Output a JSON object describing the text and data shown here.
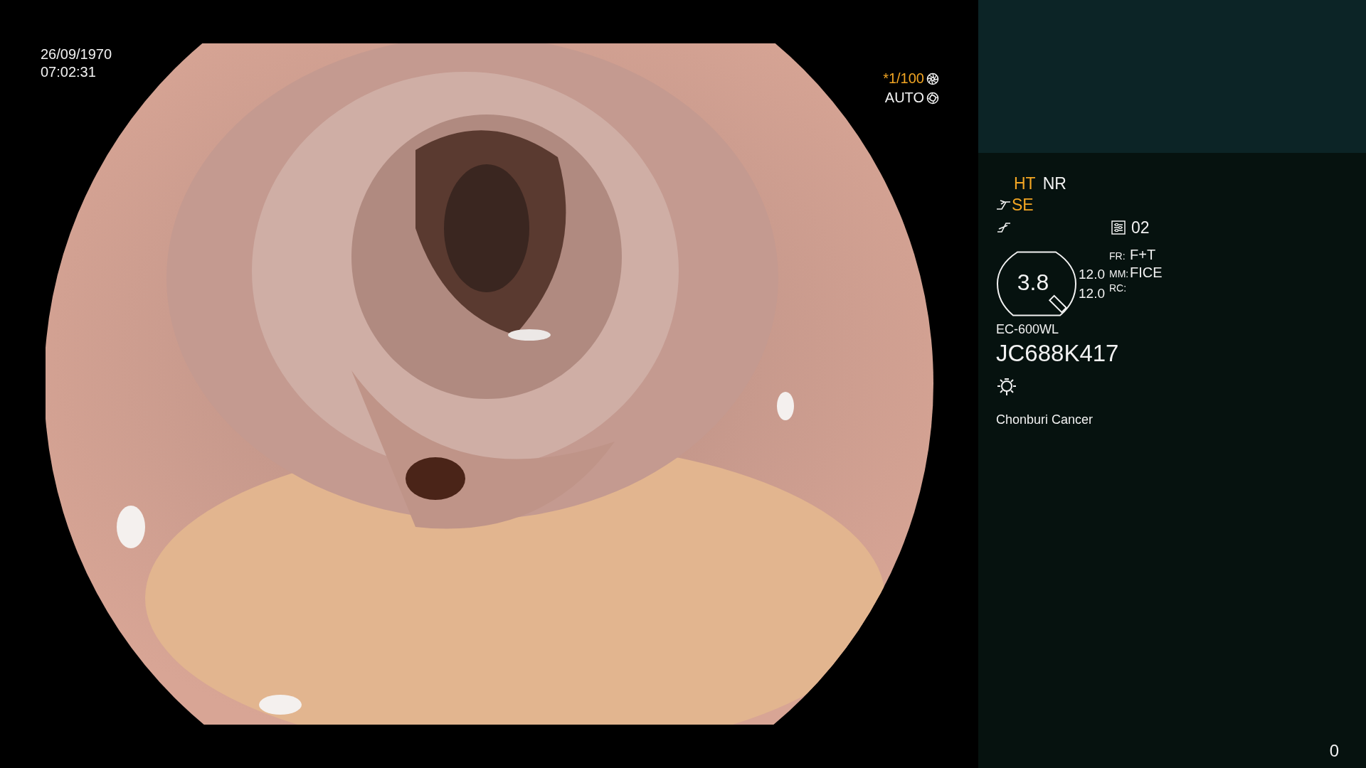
{
  "timestamp": {
    "date": "26/09/1970",
    "time": "07:02:31"
  },
  "exposure": {
    "shutter": "*1/100",
    "iris": "AUTO"
  },
  "enhancements": [
    {
      "label": "HT",
      "on": true
    },
    {
      "label": "NR",
      "on": false
    }
  ],
  "structure_enhancement": {
    "label": "SE",
    "on": true
  },
  "preset": "02",
  "zoom": {
    "value": "3.8",
    "readings": [
      "12.0",
      "12.0"
    ]
  },
  "modes": [
    {
      "label": "FR:",
      "value": "F+T"
    },
    {
      "label": "MM:",
      "value": "FICE"
    },
    {
      "label": "RC:"
    }
  ],
  "scope_model": "EC-600WL",
  "serial": "JC688K417",
  "institution": "Chonburi Cancer",
  "counter": "0"
}
